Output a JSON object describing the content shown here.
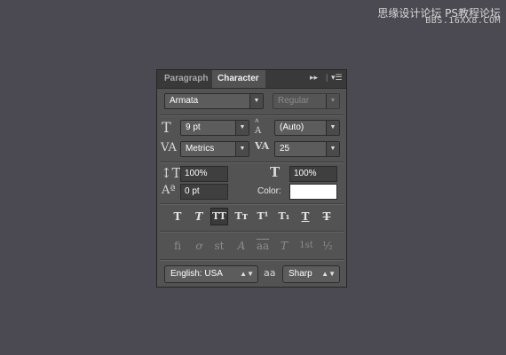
{
  "watermark": {
    "line1": "思缘设计论坛  PS教程论坛",
    "line2": "BBS.16XX8.COM"
  },
  "tabs": [
    {
      "label": "Paragraph",
      "active": false
    },
    {
      "label": "Character",
      "active": true
    }
  ],
  "tabbar_icons": {
    "collapse": "double-chevron-right-icon",
    "menu": "panel-menu-icon"
  },
  "font_family": {
    "value": "Armata"
  },
  "font_style": {
    "value": "Regular",
    "disabled": true
  },
  "font_size": {
    "value": "9 pt"
  },
  "leading": {
    "value": "(Auto)"
  },
  "kerning": {
    "value": "Metrics"
  },
  "tracking": {
    "value": "25"
  },
  "vertical_scale": {
    "value": "100%"
  },
  "horizontal_scale": {
    "value": "100%"
  },
  "baseline_shift": {
    "value": "0 pt"
  },
  "color": {
    "label": "Color:",
    "value": "#ffffff"
  },
  "style_buttons": [
    {
      "name": "faux-bold",
      "glyph": "T"
    },
    {
      "name": "faux-italic",
      "glyph": "T"
    },
    {
      "name": "all-caps",
      "glyph": "TT",
      "pressed": true
    },
    {
      "name": "small-caps",
      "glyph": "Tт"
    },
    {
      "name": "superscript",
      "glyph": "T¹"
    },
    {
      "name": "subscript",
      "glyph": "T₁"
    },
    {
      "name": "underline",
      "glyph": "T"
    },
    {
      "name": "strikethrough",
      "glyph": "T"
    }
  ],
  "opentype_buttons": [
    {
      "name": "standard-ligatures",
      "glyph": "fi"
    },
    {
      "name": "contextual-alternates",
      "glyph": "ơ"
    },
    {
      "name": "discretionary-ligatures",
      "glyph": "st"
    },
    {
      "name": "swash",
      "glyph": "A"
    },
    {
      "name": "stylistic-alternates",
      "glyph": "aa"
    },
    {
      "name": "titling-alternates",
      "glyph": "T"
    },
    {
      "name": "ordinals",
      "glyph": "1st"
    },
    {
      "name": "fractions",
      "glyph": "½"
    }
  ],
  "language": {
    "value": "English: USA"
  },
  "antialias_icon": "aa",
  "antialias": {
    "value": "Sharp"
  }
}
